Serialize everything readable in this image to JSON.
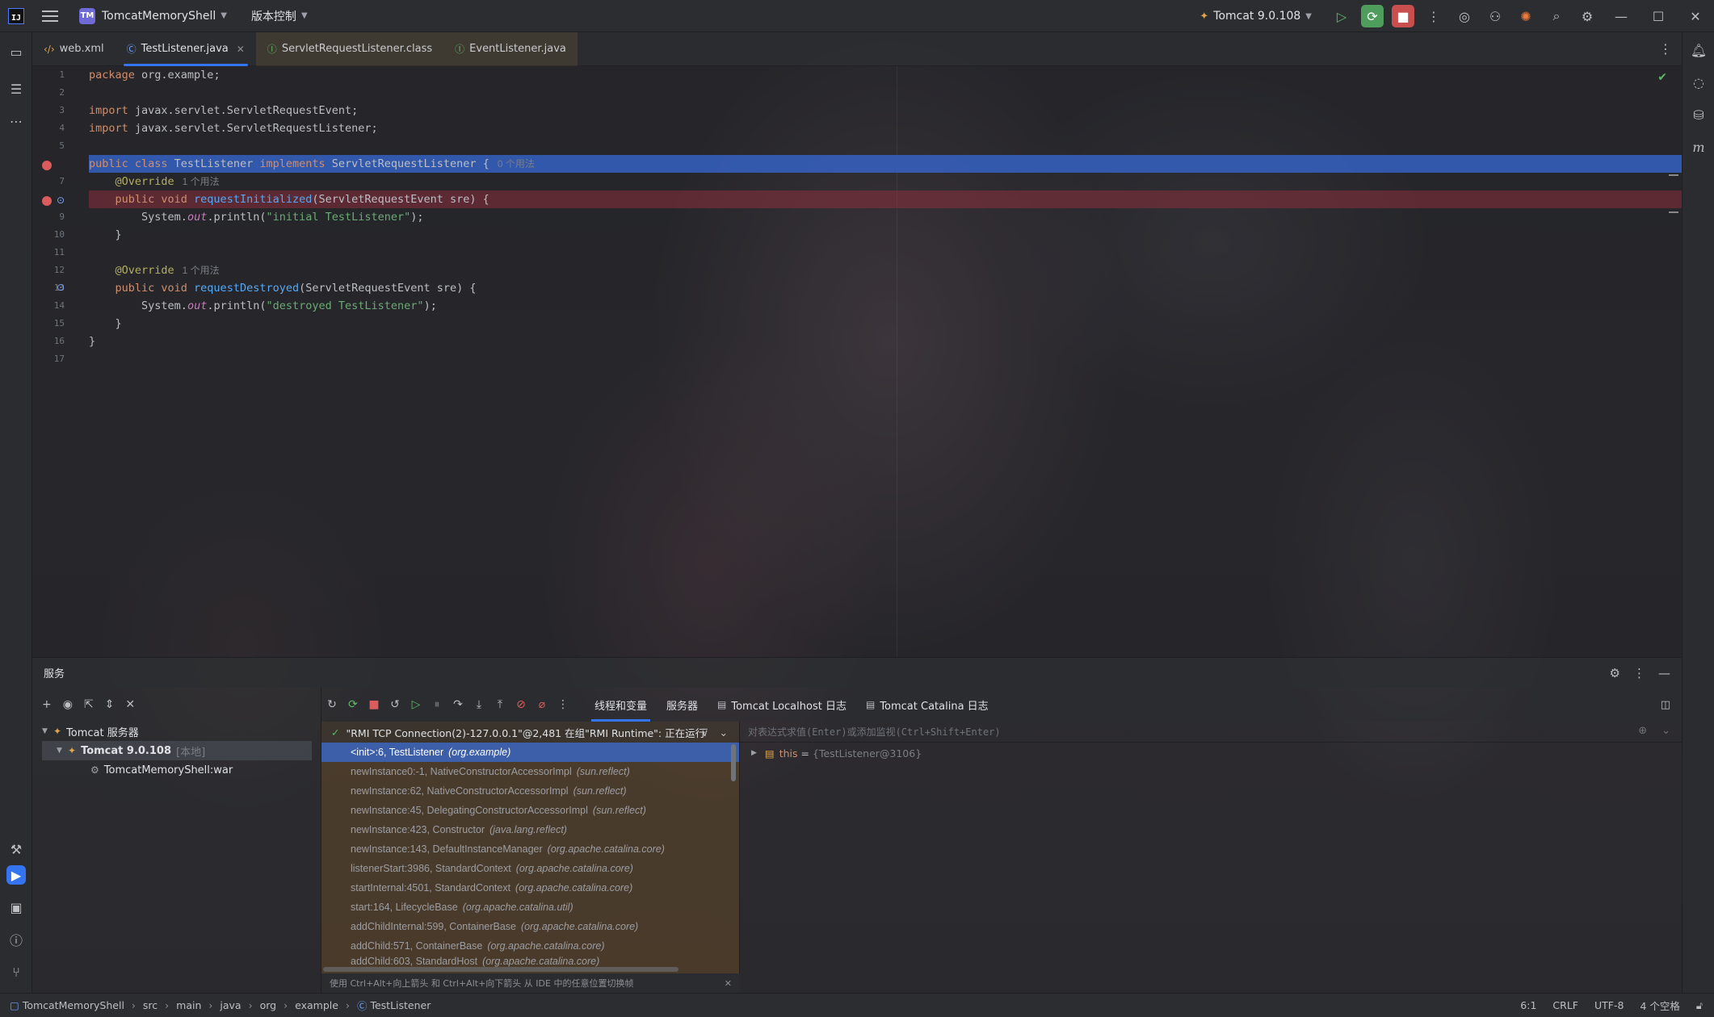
{
  "titlebar": {
    "project_chip": "TM",
    "project_name": "TomcatMemoryShell",
    "vcs_label": "版本控制",
    "run_config": "Tomcat 9.0.108"
  },
  "tabs": [
    {
      "label": "web.xml",
      "icon": "xml-file-icon"
    },
    {
      "label": "TestListener.java",
      "icon": "java-class-icon"
    },
    {
      "label": "ServletRequestListener.class",
      "icon": "interface-icon"
    },
    {
      "label": "EventListener.java",
      "icon": "interface-icon"
    }
  ],
  "editor": {
    "lines": [
      "1",
      "2",
      "3",
      "4",
      "5",
      "6",
      "7",
      "8",
      "9",
      "10",
      "11",
      "12",
      "13",
      "14",
      "15",
      "16",
      "17"
    ],
    "code": {
      "l1": [
        "package",
        " org.example;"
      ],
      "l3": [
        "import",
        " javax.servlet.ServletRequestEvent;"
      ],
      "l4": [
        "import",
        " javax.servlet.ServletRequestListener;"
      ],
      "l6": [
        "public class",
        " TestListener ",
        "implements",
        " ServletRequestListener {",
        "0 个用法"
      ],
      "l7": [
        "@Override",
        "1 个用法"
      ],
      "l8": [
        "public void",
        " requestInitialized",
        "(ServletRequestEvent sre) {"
      ],
      "l9": [
        "System.",
        "out",
        ".println(",
        "\"initial TestListener\"",
        ");"
      ],
      "l10": [
        "}"
      ],
      "l12": [
        "@Override",
        "1 个用法"
      ],
      "l13": [
        "public void",
        " requestDestroyed",
        "(ServletRequestEvent sre) {"
      ],
      "l14": [
        "System.",
        "out",
        ".println(",
        "\"destroyed TestListener\"",
        ");"
      ],
      "l15": [
        "}"
      ],
      "l16": [
        "}"
      ]
    }
  },
  "services": {
    "title": "服务",
    "tree": {
      "root": "Tomcat 服务器",
      "server": "Tomcat 9.0.108",
      "server_note": "[本地]",
      "artifact": "TomcatMemoryShell:war"
    },
    "tabs": [
      "线程和变量",
      "服务器",
      "Tomcat Localhost 日志",
      "Tomcat Catalina 日志"
    ],
    "thread": "\"RMI TCP Connection(2)-127.0.0.1\"@2,481 在组\"RMI Runtime\": 正在运行",
    "frames": [
      {
        "method": "<init>:6, TestListener",
        "pkg": "(org.example)"
      },
      {
        "method": "newInstance0:-1, NativeConstructorAccessorImpl",
        "pkg": "(sun.reflect)"
      },
      {
        "method": "newInstance:62, NativeConstructorAccessorImpl",
        "pkg": "(sun.reflect)"
      },
      {
        "method": "newInstance:45, DelegatingConstructorAccessorImpl",
        "pkg": "(sun.reflect)"
      },
      {
        "method": "newInstance:423, Constructor",
        "pkg": "(java.lang.reflect)"
      },
      {
        "method": "newInstance:143, DefaultInstanceManager",
        "pkg": "(org.apache.catalina.core)"
      },
      {
        "method": "listenerStart:3986, StandardContext",
        "pkg": "(org.apache.catalina.core)"
      },
      {
        "method": "startInternal:4501, StandardContext",
        "pkg": "(org.apache.catalina.core)"
      },
      {
        "method": "start:164, LifecycleBase",
        "pkg": "(org.apache.catalina.util)"
      },
      {
        "method": "addChildInternal:599, ContainerBase",
        "pkg": "(org.apache.catalina.core)"
      },
      {
        "method": "addChild:571, ContainerBase",
        "pkg": "(org.apache.catalina.core)"
      },
      {
        "method": "addChild:603, StandardHost",
        "pkg": "(org.apache.catalina.core)"
      }
    ],
    "hint": "使用 Ctrl+Alt+向上箭头 和 Ctrl+Alt+向下箭头 从 IDE 中的任意位置切换帧",
    "eval_placeholder": "对表达式求值(Enter)或添加监视(Ctrl+Shift+Enter)",
    "variable": {
      "name": "this",
      "eq": "=",
      "value": "{TestListener@3106}"
    }
  },
  "statusbar": {
    "crumbs": [
      "TomcatMemoryShell",
      "src",
      "main",
      "java",
      "org",
      "example",
      "TestListener"
    ],
    "position": "6:1",
    "line_sep": "CRLF",
    "encoding": "UTF-8",
    "indent": "4 个空格"
  },
  "colors": {
    "accent": "#3574f0",
    "selection": "#3562c3",
    "keyword": "#cf8e6d",
    "function": "#56a8f5",
    "string": "#6aab73",
    "annotation": "#b3ae60",
    "breakpoint": "#db5c5c"
  }
}
